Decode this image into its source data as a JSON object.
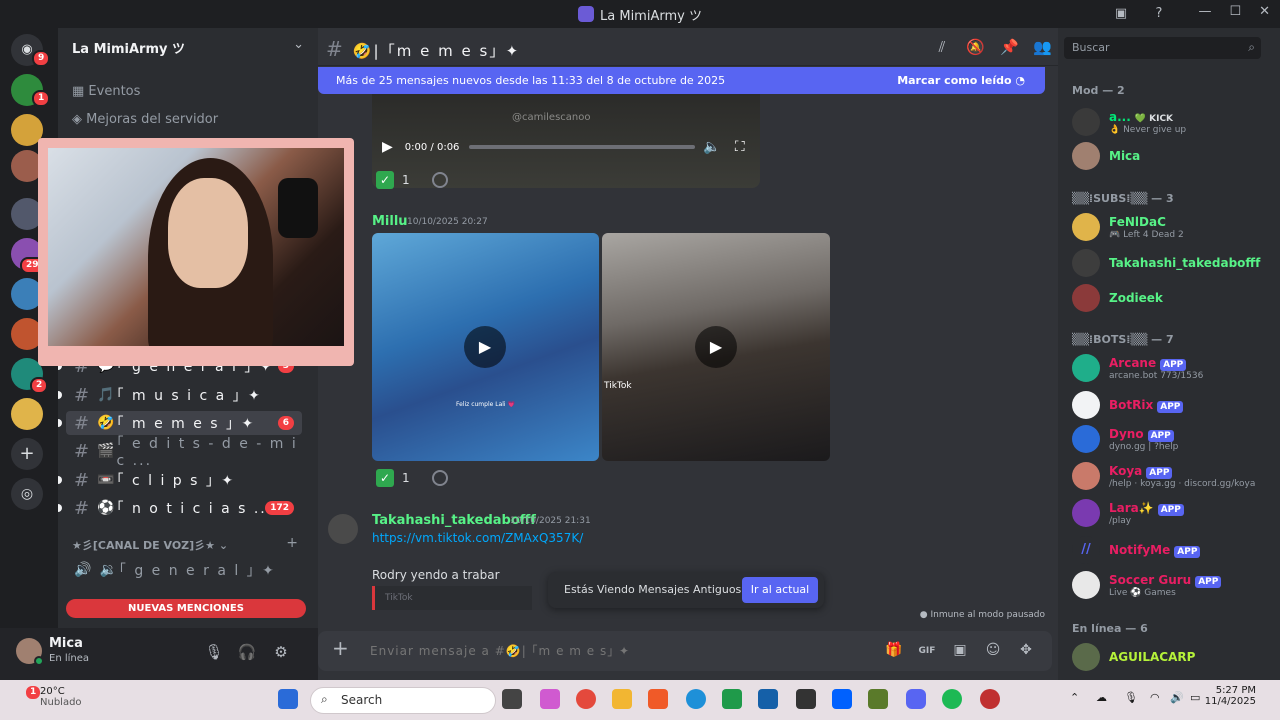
{
  "window": {
    "title": "La MimiArmy ツ",
    "controls": [
      "—",
      "☐",
      "✕"
    ]
  },
  "rail": {
    "badges": [
      "9",
      "1",
      "29",
      "2"
    ]
  },
  "guild": {
    "name": "La MimiArmy ツ"
  },
  "nav": {
    "events": "Eventos",
    "boosts": "Mejoras del servidor"
  },
  "channels": [
    {
      "name": "｢ g e n e r a l ｣ ✦",
      "emoji": "💬",
      "badge": "3"
    },
    {
      "name": "｢ m u s i c a ｣ ✦",
      "emoji": "🎵",
      "badge": ""
    },
    {
      "name": "｢ m e m e s ｣ ✦",
      "emoji": "🤣",
      "badge": "6"
    },
    {
      "name": "｢ e d i t s - d e - m i c ...",
      "emoji": "🎬",
      "badge": ""
    },
    {
      "name": "｢ c l i p s ｣ ✦",
      "emoji": "📼",
      "badge": ""
    },
    {
      "name": "｢ n o t i c i a s ...",
      "emoji": "⚽",
      "badge": "172"
    }
  ],
  "voice_category": "★彡[CANAL DE VOZ]彡★",
  "voice_channel": "｢ g e n e r a l ｣ ✦",
  "new_mentions": "NUEVAS MENCIONES",
  "user": {
    "name": "Mica",
    "status": "En línea"
  },
  "header": {
    "channel": "🤣| ｢m e m e s｣ ✦"
  },
  "new_messages_bar": {
    "text": "Más de 25 mensajes nuevos desde las 11:33 del 8 de octubre de 2025",
    "action": "Marcar como leído"
  },
  "video": {
    "time": "0:00 / 0:06",
    "watermark": "@camilescanoo"
  },
  "messages": [
    {
      "reaction_count": "1"
    },
    {
      "author": "Millu",
      "timestamp": "10/10/2025 20:27",
      "reaction_count": "1",
      "media_text": "Feliz cumple Lali 💗",
      "media_text2": "TikTok"
    },
    {
      "author": "Takahashi_takedabofff",
      "timestamp": "10/10/2025 21:31",
      "link": "https://vm.tiktok.com/ZMAxQ357K/",
      "text": "Rodry yendo a trabar",
      "embed": "TikTok"
    }
  ],
  "old_messages": {
    "text": "Estás Viendo Mensajes Antiguos",
    "button": "Ir al actual"
  },
  "paused": "Inmune al modo pausado",
  "composer": {
    "placeholder": "Enviar mensaje a #🤣| ｢m e m e s｣ ✦"
  },
  "search": {
    "placeholder": "Buscar"
  },
  "member_sections": {
    "mod": "Mod — 2",
    "subs": "▒▒⁞SUBS⁞▒▒ — 3",
    "bots": "▒▒⁞BOTS⁞▒▒ — 7",
    "online": "En línea — 6"
  },
  "members": {
    "mod": [
      {
        "name": "a...",
        "tag": "💚 KICK",
        "status": "👌 Never give up",
        "color": "#00e676"
      },
      {
        "name": "Mica",
        "status": "",
        "color": "#57f287"
      }
    ],
    "subs": [
      {
        "name": "FeNlDaC",
        "status": "🎮 Left 4 Dead 2",
        "color": "#57f287"
      },
      {
        "name": "Takahashi_takedabofff",
        "status": "",
        "color": "#57f287"
      },
      {
        "name": "Zodieek",
        "status": "",
        "color": "#57f287"
      }
    ],
    "bots": [
      {
        "name": "Arcane",
        "status": "arcane.bot 773/1536",
        "color": "#e91e63"
      },
      {
        "name": "BotRix",
        "status": "",
        "color": "#e91e63"
      },
      {
        "name": "Dyno",
        "status": "dyno.gg | ?help",
        "color": "#e91e63"
      },
      {
        "name": "Koya",
        "status": "/help · koya.gg · discord.gg/koya",
        "color": "#e91e63"
      },
      {
        "name": "Lara✨",
        "status": "/play",
        "color": "#e91e63"
      },
      {
        "name": "NotifyMe",
        "status": "",
        "color": "#e91e63"
      },
      {
        "name": "Soccer Guru",
        "status": "Live ⚽ Games",
        "color": "#e91e63"
      }
    ],
    "online": [
      {
        "name": "AGUILACARP",
        "status": "",
        "color": "#b5f23a"
      }
    ],
    "app_label": "APP"
  },
  "taskbar": {
    "weather_temp": "20°C",
    "weather_desc": "Nublado",
    "weather_badge": "1",
    "search": "Search",
    "time": "5:27 PM",
    "date": "11/4/2025"
  },
  "colors": {
    "accent": "#5865f2",
    "mention": "#da373c",
    "link": "#00a8fc"
  }
}
